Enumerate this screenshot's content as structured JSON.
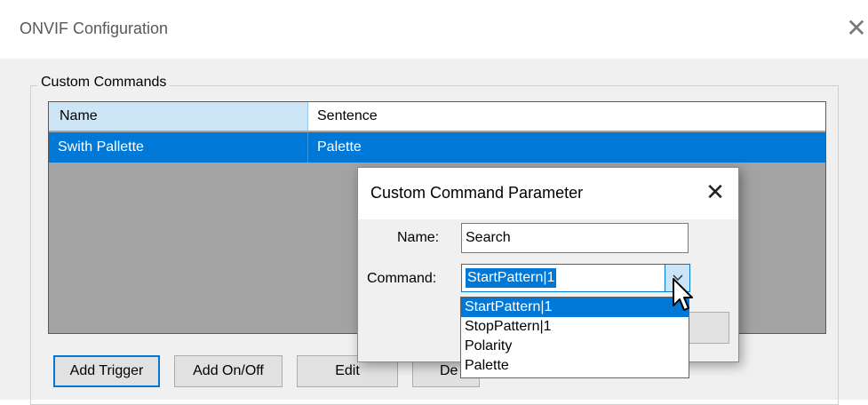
{
  "window": {
    "title": "ONVIF Configuration",
    "close_glyph": "✕"
  },
  "group": {
    "label": "Custom Commands"
  },
  "grid": {
    "columns": [
      "Name",
      "Sentence"
    ],
    "rows": [
      {
        "name": "Swith Pallette",
        "sentence": "Palette",
        "selected": true
      }
    ]
  },
  "buttons": {
    "add_trigger": "Add Trigger",
    "add_on_off": "Add On/Off",
    "edit": "Edit",
    "delete_partial": "De"
  },
  "dialog": {
    "title": "Custom Command Parameter",
    "close_glyph": "✕",
    "name_label": "Name:",
    "name_value": "Search",
    "command_label": "Command:",
    "command_value": "StartPattern|1",
    "options": [
      "StartPattern|1",
      "StopPattern|1",
      "Polarity",
      "Palette"
    ],
    "selected_option_index": 0
  },
  "colors": {
    "selection": "#0078d7",
    "header_highlight": "#cce6f8",
    "grid_background": "#a3a3a3"
  },
  "icons": {
    "window_close": "close-icon",
    "dialog_close": "close-icon",
    "combo_arrow": "chevron-down-icon",
    "pointer": "mouse-cursor-icon"
  }
}
